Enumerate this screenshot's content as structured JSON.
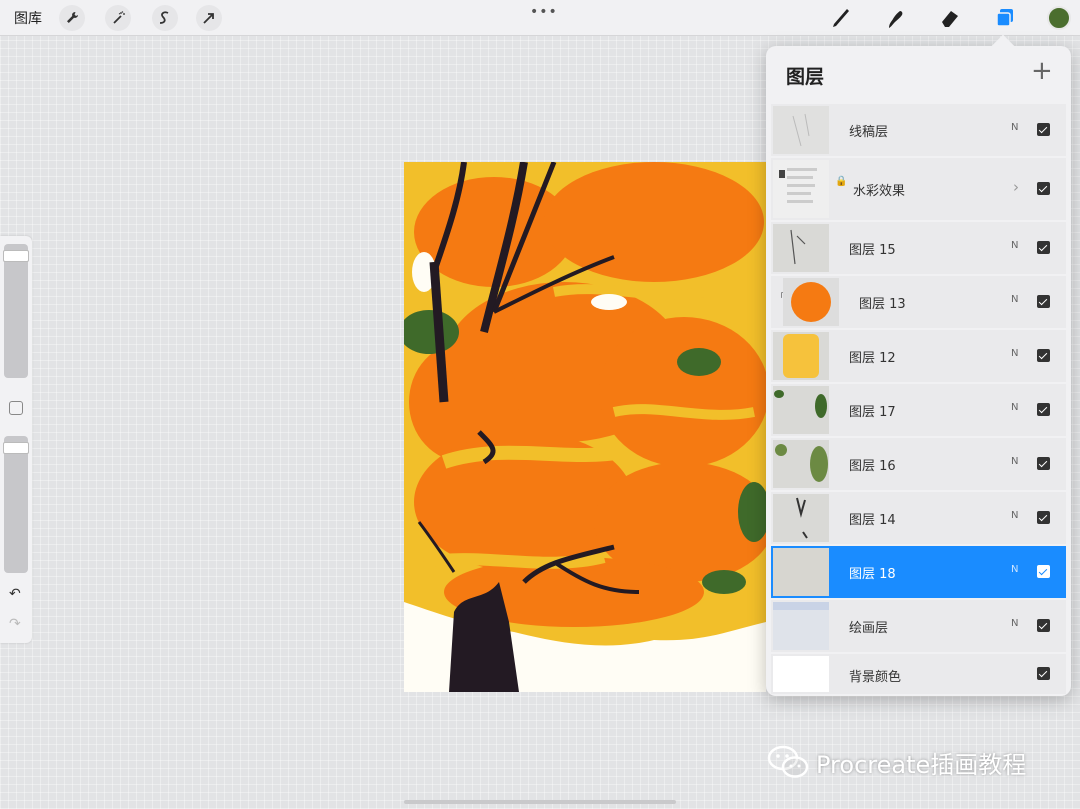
{
  "topbar": {
    "gallery_label": "图库",
    "icons": [
      "wrench-icon",
      "magic-wand-icon",
      "selection-icon",
      "transform-arrow-icon"
    ],
    "more_dots": "•••",
    "right_tools": [
      "brush-icon",
      "smudge-icon",
      "eraser-icon",
      "layers-icon"
    ],
    "current_color": "#4b6e2e",
    "active_tool_color": "#1a8cff"
  },
  "sidebar": {
    "brush_size_level": 0.05,
    "opacity_level": 0.05,
    "undo_icon": "↶",
    "redo_icon": "↷"
  },
  "layers_panel": {
    "title": "图层",
    "add_icon": "+",
    "layers": [
      {
        "name": "线稿层",
        "blend": "N",
        "visible": true
      },
      {
        "name": "水彩效果",
        "blend": "",
        "visible": true,
        "locked": true,
        "group": true
      },
      {
        "name": "图层 15",
        "blend": "N",
        "visible": true
      },
      {
        "name": "图层 13",
        "blend": "N",
        "visible": true,
        "clipped": true
      },
      {
        "name": "图层 12",
        "blend": "N",
        "visible": true
      },
      {
        "name": "图层 17",
        "blend": "N",
        "visible": true
      },
      {
        "name": "图层 16",
        "blend": "N",
        "visible": true
      },
      {
        "name": "图层 14",
        "blend": "N",
        "visible": true
      },
      {
        "name": "图层 18",
        "blend": "N",
        "visible": true,
        "selected": true
      },
      {
        "name": "绘画层",
        "blend": "N",
        "visible": true
      },
      {
        "name": "背景颜色",
        "blend": "",
        "visible": true
      }
    ]
  },
  "watermark": {
    "text": "Procreate插画教程",
    "icon": "wechat-icon"
  },
  "colors": {
    "orange": "#f57a12",
    "yellow": "#f2bf2a",
    "trunk": "#231a23",
    "leaf_green": "#3f6a2a"
  }
}
